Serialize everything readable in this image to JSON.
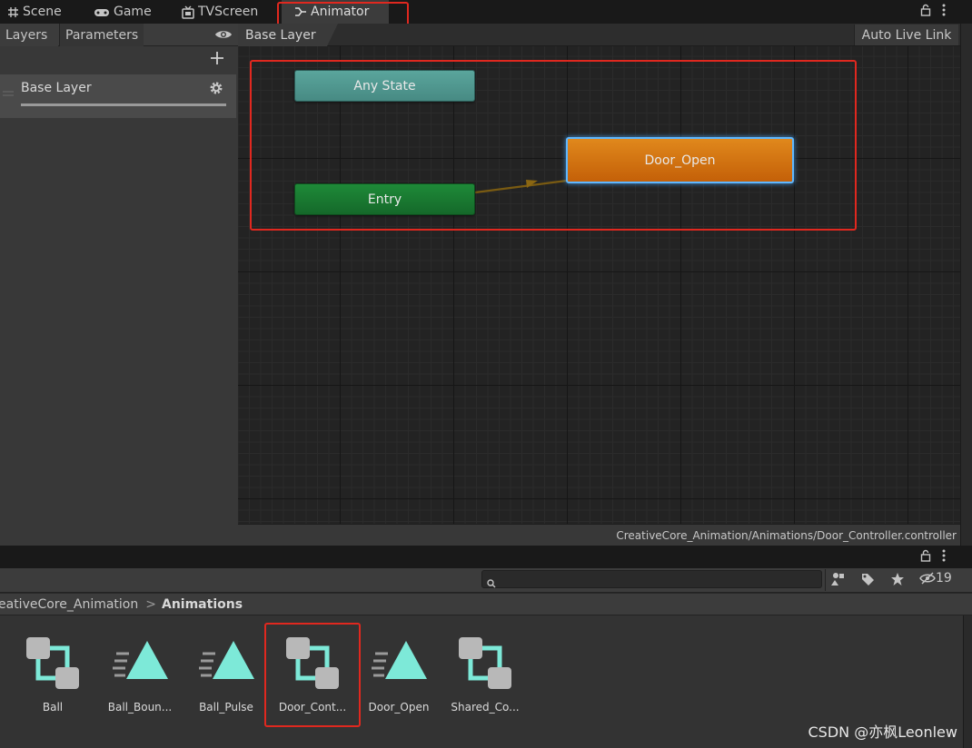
{
  "tabs": [
    {
      "label": "Scene",
      "icon": "grid-icon"
    },
    {
      "label": "Game",
      "icon": "gamepad-icon"
    },
    {
      "label": "TVScreen",
      "icon": "tv-icon"
    },
    {
      "label": "Animator",
      "icon": "animator-icon"
    }
  ],
  "left_panel": {
    "tab_layers": "Layers",
    "tab_parameters": "Parameters",
    "layer_name": "Base Layer"
  },
  "graph": {
    "breadcrumb": "Base Layer",
    "auto_live_link": "Auto Live Link",
    "states": {
      "any_state": "Any State",
      "entry": "Entry",
      "door_open": "Door_Open"
    },
    "footer_path": "CreativeCore_Animation/Animations/Door_Controller.controller"
  },
  "project": {
    "search_placeholder": "",
    "hidden_count": "19",
    "breadcrumb_parent": "eativeCore_Animation",
    "breadcrumb_separator": ">",
    "breadcrumb_current": "Animations",
    "assets": [
      {
        "label": "Ball",
        "type": "controller"
      },
      {
        "label": "Ball_Boun...",
        "type": "clip"
      },
      {
        "label": "Ball_Pulse",
        "type": "clip"
      },
      {
        "label": "Door_Cont...",
        "type": "controller"
      },
      {
        "label": "Door_Open",
        "type": "clip"
      },
      {
        "label": "Shared_Co...",
        "type": "controller"
      }
    ]
  },
  "watermark": "CSDN @亦枫Leonlew",
  "colors": {
    "any_state": "#4f9a92",
    "entry": "#1a7a30",
    "default_state": "#d06c0c",
    "highlight": "#e0281f",
    "asset_icon": "#7de9d8"
  }
}
